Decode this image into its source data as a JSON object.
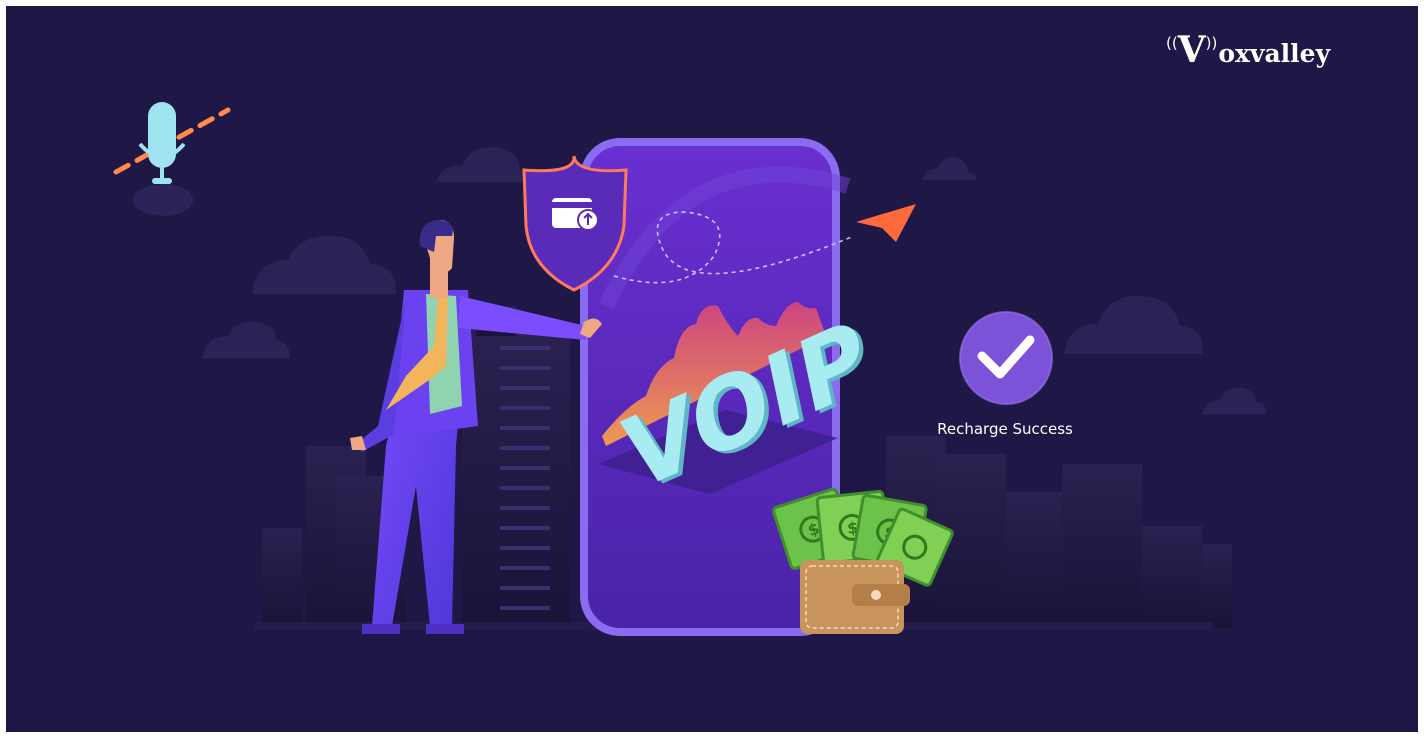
{
  "brand": {
    "wave_left": "((",
    "letter": "V",
    "wave_right": "))",
    "rest": "oxvalley"
  },
  "phone": {
    "word": "VOIP"
  },
  "status": {
    "label": "Recharge Success"
  },
  "icons": [
    "microphone-icon",
    "shield-wallet-icon",
    "paper-plane-icon",
    "check-circle-icon",
    "wallet-money-icon"
  ],
  "colors": {
    "background": "#1f1746",
    "phone": "#5b2bc4",
    "phone_border": "#8a6cf0",
    "accent_purple": "#7c52d8",
    "voip_text": "#9fe9f0",
    "money_green": "#6cc24a",
    "wallet_brown": "#c9935c",
    "plane_orange": "#ff6a3d"
  }
}
